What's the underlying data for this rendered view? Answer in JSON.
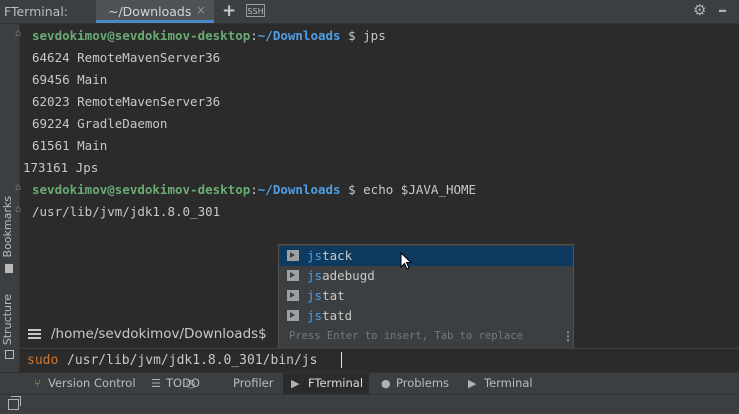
{
  "titlebar": {
    "app_name": "FTerminal:",
    "tab_label": "~/Downloads",
    "tab_close": "×",
    "add_tab": "+",
    "ssh_badge": "SSH",
    "settings_icon": "gear-icon",
    "hide_icon": "minus-icon"
  },
  "sidebar": {
    "bookmarks": "Bookmarks",
    "structure": "Structure"
  },
  "terminal": {
    "prompt_user": "sevdokimov@sevdokimov-desktop",
    "prompt_sep": ":",
    "prompt_path": "~/Downloads",
    "cmd1": "$ jps",
    "output": [
      "64624 RemoteMavenServer36",
      "69456 Main",
      "62023 RemoteMavenServer36",
      "69224 GradleDaemon",
      "61561 Main",
      "173161 Jps"
    ],
    "cmd2": "$ echo $JAVA_HOME",
    "output2": "/usr/lib/jvm/jdk1.8.0_301"
  },
  "completion": {
    "prefix": "js",
    "items": [
      "tack",
      "adebugd",
      "tat",
      "tatd"
    ],
    "hint": "Press Enter to insert, Tab to replace",
    "more_icon": "⋮"
  },
  "cwd": "/home/sevdokimov/Downloads$",
  "input": {
    "sudo": "sudo",
    "command": "/usr/lib/jvm/jdk1.8.0_301/bin/js"
  },
  "toolwindows": [
    {
      "label": "Version Control",
      "icon": "branch-icon"
    },
    {
      "label": "TODO",
      "icon": "list-icon"
    },
    {
      "label": "Profiler",
      "icon": "profiler-icon"
    },
    {
      "label": "FTerminal",
      "icon": "terminal-icon"
    },
    {
      "label": "Problems",
      "icon": "problems-icon"
    },
    {
      "label": "Terminal",
      "icon": "terminal-icon"
    }
  ]
}
